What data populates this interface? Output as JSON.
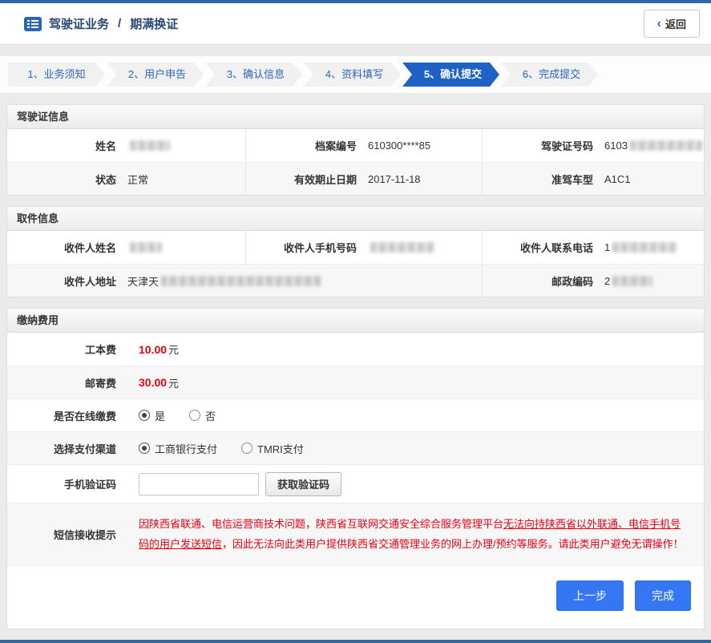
{
  "header": {
    "title": "驾驶证业务",
    "separator": "/",
    "subtitle": "期满换证",
    "back_label": "返回"
  },
  "icons": {
    "back_chevron": "‹"
  },
  "steps": [
    {
      "label": "1、业务须知",
      "active": false
    },
    {
      "label": "2、用户申告",
      "active": false
    },
    {
      "label": "3、确认信息",
      "active": false
    },
    {
      "label": "4、资料填写",
      "active": false
    },
    {
      "label": "5、确认提交",
      "active": true
    },
    {
      "label": "6、完成提交",
      "active": false
    }
  ],
  "license": {
    "title": "驾驶证信息",
    "name_label": "姓名",
    "file_number_label": "档案编号",
    "file_number_value": "610300****85",
    "license_number_label": "驾驶证号码",
    "license_number_prefix": "6103",
    "status_label": "状态",
    "status_value": "正常",
    "expiry_label": "有效期止日期",
    "expiry_value": "2017-11-18",
    "vehicle_class_label": "准驾车型",
    "vehicle_class_value": "A1C1"
  },
  "pickup": {
    "title": "取件信息",
    "recipient_name_label": "收件人姓名",
    "recipient_mobile_label": "收件人手机号码",
    "recipient_phone_label": "收件人联系电话",
    "recipient_phone_prefix": "1",
    "address_label": "收件人地址",
    "address_prefix": "天津天",
    "postcode_label": "邮政编码",
    "postcode_prefix": "2"
  },
  "fees": {
    "title": "缴纳费用",
    "production_fee_label": "工本费",
    "production_fee_value": "10.00",
    "mailing_fee_label": "邮寄费",
    "mailing_fee_value": "30.00",
    "currency": "元",
    "pay_online_label": "是否在线缴费",
    "option_yes": "是",
    "option_no": "否",
    "channel_label": "选择支付渠道",
    "channel_icbc": "工商银行支付",
    "channel_tmri": "TMRI支付",
    "sms_code_label": "手机验证码",
    "get_code_button": "获取验证码",
    "notice_label": "短信接收提示",
    "notice_pre": "因陕西省联通、电信运营商技术问题，陕西省互联网交通安全综合服务管理平台",
    "notice_underline": "无法向持陕西省以外联通、电信手机号码的用户发送短信",
    "notice_post": "，因此无法向此类用户提供陕西省交通管理业务的网上办理/预约等服务。请此类用户避免无谓操作！"
  },
  "actions": {
    "previous": "上一步",
    "finish": "完成"
  },
  "colors": {
    "top_bottom_line": "#3468a4",
    "accent_blue": "#2a66b8",
    "active_step_bg": "#1d62c4",
    "alert_red": "#e60012",
    "primary_button_blue": "#3577f3"
  }
}
